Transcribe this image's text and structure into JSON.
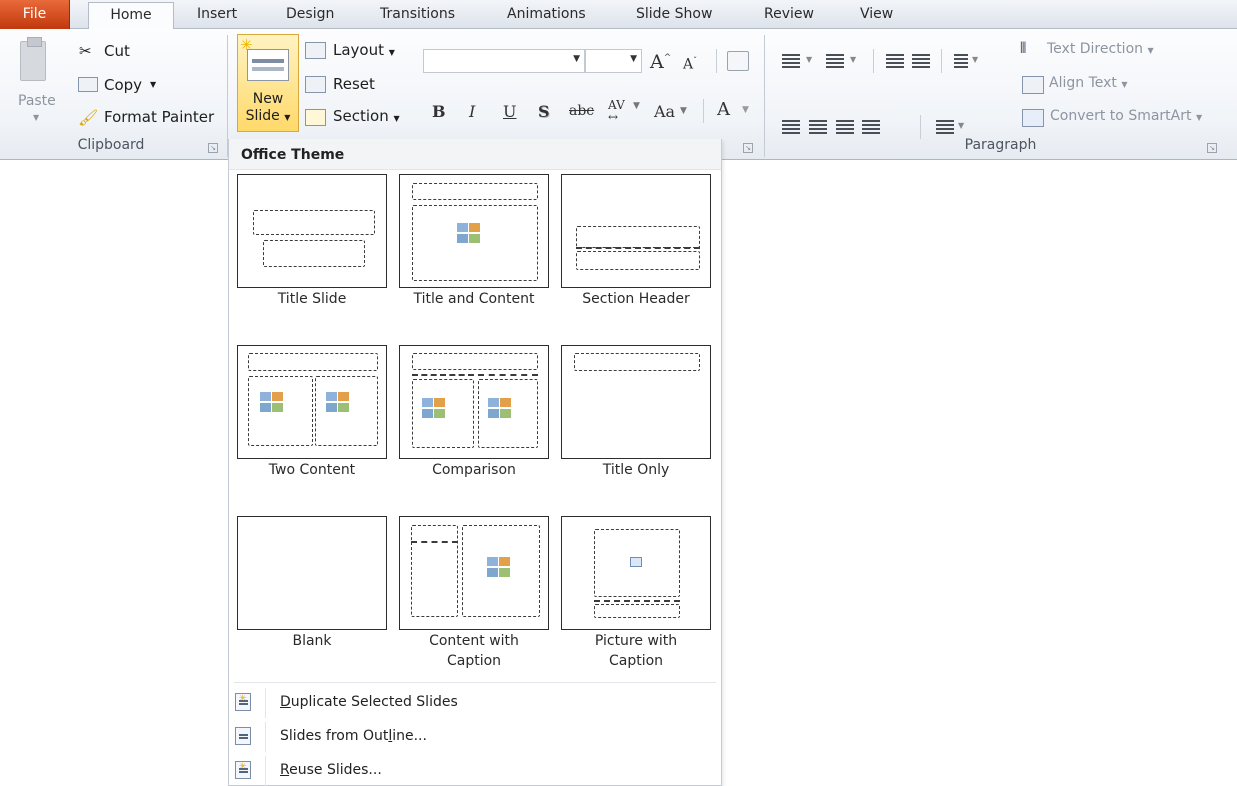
{
  "tabs": {
    "file": "File",
    "home": "Home",
    "insert": "Insert",
    "design": "Design",
    "transitions": "Transitions",
    "animations": "Animations",
    "slide_show": "Slide Show",
    "review": "Review",
    "view": "View"
  },
  "clipboard": {
    "paste": "Paste",
    "cut": "Cut",
    "copy": "Copy",
    "format_painter": "Format Painter",
    "group_label": "Clipboard"
  },
  "slides": {
    "new_slide_line1": "New",
    "new_slide_line2": "Slide",
    "layout": "Layout",
    "reset": "Reset",
    "section": "Section"
  },
  "font": {
    "bold": "B",
    "italic": "I",
    "underline": "U",
    "shadow": "S",
    "strikethrough": "abc",
    "spacing": "AV",
    "change_case": "Aa",
    "font_color": "A",
    "grow": "A",
    "shrink": "A"
  },
  "paragraph": {
    "text_direction": "Text Direction",
    "align_text": "Align Text",
    "convert_smartart": "Convert to SmartArt",
    "group_label": "Paragraph"
  },
  "gallery": {
    "header": "Office Theme",
    "layouts": [
      {
        "line1": "Title Slide",
        "line2": ""
      },
      {
        "line1": "Title and Content",
        "line2": ""
      },
      {
        "line1": "Section Header",
        "line2": ""
      },
      {
        "line1": "Two Content",
        "line2": ""
      },
      {
        "line1": "Comparison",
        "line2": ""
      },
      {
        "line1": "Title Only",
        "line2": ""
      },
      {
        "line1": "Blank",
        "line2": ""
      },
      {
        "line1": "Content with",
        "line2": "Caption"
      },
      {
        "line1": "Picture with",
        "line2": "Caption"
      }
    ]
  },
  "menu": {
    "duplicate": {
      "key": "D",
      "rest": "uplicate Selected Slides"
    },
    "outline": {
      "pre": "Slides from Out",
      "key": "l",
      "rest": "ine..."
    },
    "reuse": {
      "key": "R",
      "rest": "euse Slides..."
    }
  },
  "colors": {
    "file_tab": "#c1380d",
    "highlight": "#ffd96a"
  }
}
